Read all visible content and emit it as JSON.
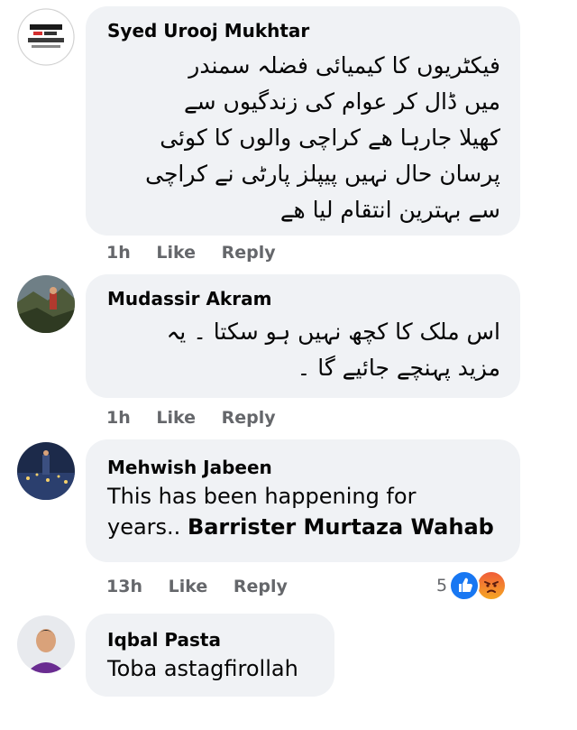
{
  "comments": [
    {
      "author": "Syed Urooj Mukhtar",
      "avatar_icon": "news-logo-avatar",
      "lines": [
        "فیکٹریوں کا کیمیائی فضلہ سمندر",
        "میں ڈال کر عوام کی زندگیوں سے",
        "کھیلا جارہا ھے کراچی والوں کا کوئی",
        "پرسان حال نہیں پیپلز پارٹی نے کراچی",
        "سے بہترین انتقام لیا ھے"
      ],
      "time": "1h",
      "like_label": "Like",
      "reply_label": "Reply"
    },
    {
      "author": "Mudassir Akram",
      "avatar_icon": "landscape-photo-avatar",
      "lines": [
        "اس ملک کا کچھ نہیں ہو سکتا ۔ یہ",
        "مزید پہنچے جائیے گا ۔"
      ],
      "time": "1h",
      "like_label": "Like",
      "reply_label": "Reply"
    },
    {
      "author": "Mehwish Jabeen",
      "avatar_icon": "night-scene-avatar",
      "text_line1": "This has been happening for",
      "text_line2_prefix": "years.. ",
      "mention": "Barrister Murtaza Wahab",
      "time": "13h",
      "like_label": "Like",
      "reply_label": "Reply",
      "reaction_count": "5",
      "reaction_icons": [
        "like-reaction-icon",
        "angry-reaction-icon"
      ]
    },
    {
      "author": "Iqbal Pasta",
      "avatar_icon": "person-photo-avatar",
      "text": "Toba astagfirollah"
    }
  ],
  "colors": {
    "bubble": "#f0f2f5",
    "meta_text": "#65676b",
    "like_blue": "#1877f2",
    "angry_orange": "#f05d3a"
  }
}
